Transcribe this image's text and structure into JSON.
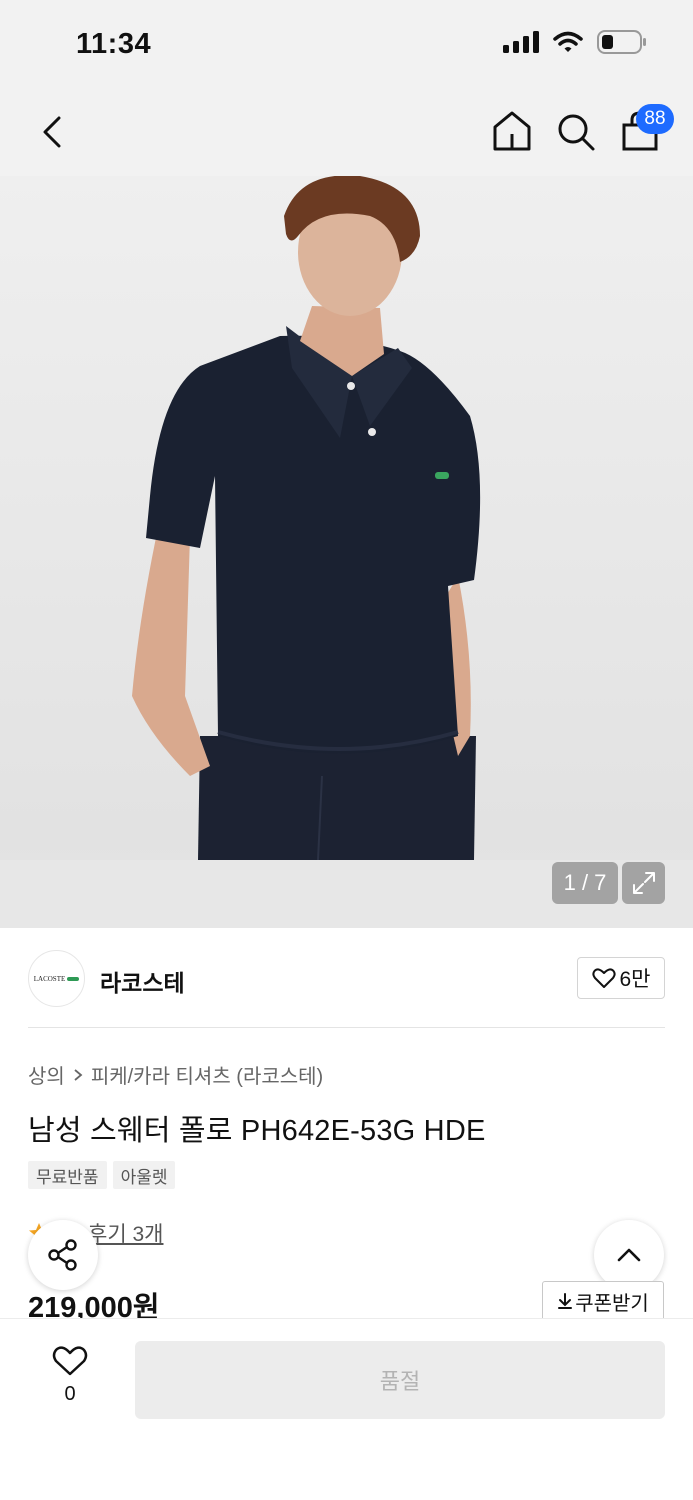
{
  "status_bar": {
    "time": "11:34"
  },
  "nav": {
    "cart_badge": "88"
  },
  "gallery": {
    "counter": "1 / 7"
  },
  "brand": {
    "name": "라코스테",
    "logo_text": "LACOSTE",
    "like_count": "6만"
  },
  "breadcrumb": {
    "category": "상의",
    "subcategory": "피케/카라 티셔츠 (라코스테)"
  },
  "product": {
    "title": "남성 스웨터 폴로 PH642E-53G HDE",
    "tags": [
      "무료반품",
      "아울렛"
    ],
    "review_text": "후기 3개",
    "price": "219,000원"
  },
  "coupon": {
    "label": "쿠폰받기"
  },
  "bottom": {
    "wish_count": "0",
    "cta_label": "품절"
  },
  "colors": {
    "badge": "#1e6bff",
    "shirt": "#1a2131",
    "rating_star": "#f5a623"
  },
  "icons": [
    "back-chevron-icon",
    "home-icon",
    "search-icon",
    "shopping-bag-icon",
    "expand-icon",
    "heart-icon",
    "star-icon",
    "share-icon",
    "chevron-up-icon",
    "download-arrow-icon"
  ]
}
